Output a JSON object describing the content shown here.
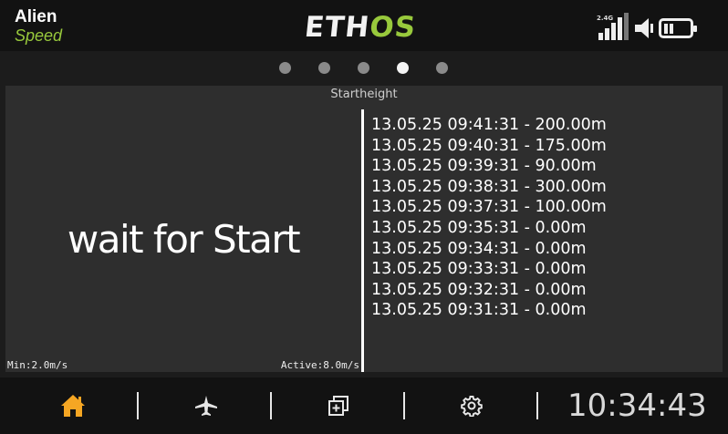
{
  "header": {
    "model_name": "Alien",
    "model_subtitle": "Speed",
    "logo_white": "ETH",
    "logo_green": "OS",
    "rf_label": "2.4G",
    "accent_color": "#98c93c"
  },
  "pager": {
    "count": 5,
    "active_index": 3
  },
  "widget": {
    "title": "Startheight",
    "status_text": "wait for Start",
    "min_label": "Min:2.0m/s",
    "active_label": "Active:8.0m/s",
    "log": [
      "13.05.25 09:41:31 - 200.00m",
      "13.05.25 09:40:31 - 175.00m",
      "13.05.25 09:39:31 - 90.00m",
      "13.05.25 09:38:31 - 300.00m",
      "13.05.25 09:37:31 - 100.00m",
      "13.05.25 09:35:31 - 0.00m",
      "13.05.25 09:34:31 - 0.00m",
      "13.05.25 09:33:31 - 0.00m",
      "13.05.25 09:32:31 - 0.00m",
      "13.05.25 09:31:31 - 0.00m"
    ]
  },
  "footer": {
    "nav_icons": [
      "home-icon",
      "airplane-icon",
      "layers-icon",
      "gear-icon"
    ],
    "active_color": "#f5a623",
    "clock": "10:34:43"
  }
}
